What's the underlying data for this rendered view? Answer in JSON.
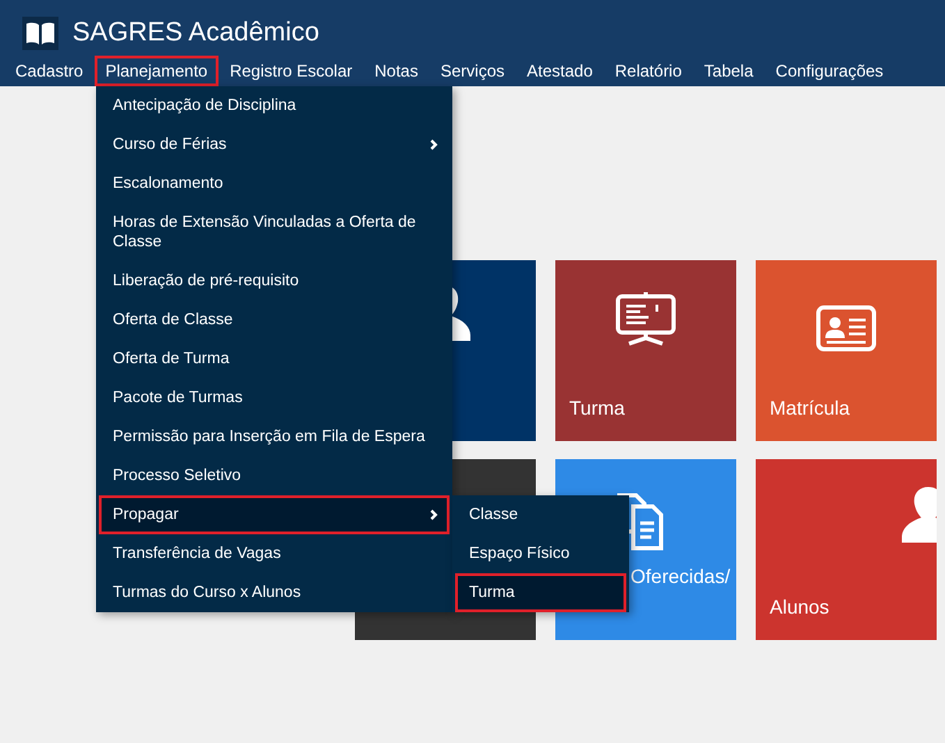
{
  "header": {
    "title": "SAGRES Acadêmico"
  },
  "nav": [
    {
      "label": "Cadastro",
      "selected": false
    },
    {
      "label": "Planejamento",
      "selected": true
    },
    {
      "label": "Registro Escolar",
      "selected": false
    },
    {
      "label": "Notas",
      "selected": false
    },
    {
      "label": "Serviços",
      "selected": false
    },
    {
      "label": "Atestado",
      "selected": false
    },
    {
      "label": "Relatório",
      "selected": false
    },
    {
      "label": "Tabela",
      "selected": false
    },
    {
      "label": "Configurações",
      "selected": false
    }
  ],
  "menu": [
    {
      "label": "Antecipação de Disciplina",
      "selected": false,
      "has_submenu": false
    },
    {
      "label": "Curso de Férias",
      "selected": false,
      "has_submenu": true
    },
    {
      "label": "Escalonamento",
      "selected": false,
      "has_submenu": false
    },
    {
      "label": "Horas de Extensão Vinculadas a Oferta de Classe",
      "selected": false,
      "has_submenu": false
    },
    {
      "label": "Liberação de pré-requisito",
      "selected": false,
      "has_submenu": false
    },
    {
      "label": "Oferta de Classe",
      "selected": false,
      "has_submenu": false
    },
    {
      "label": "Oferta de Turma",
      "selected": false,
      "has_submenu": false
    },
    {
      "label": "Pacote de Turmas",
      "selected": false,
      "has_submenu": false
    },
    {
      "label": "Permissão para Inserção em Fila de Espera",
      "selected": false,
      "has_submenu": false
    },
    {
      "label": "Processo Seletivo",
      "selected": false,
      "has_submenu": false
    },
    {
      "label": "Propagar",
      "selected": true,
      "has_submenu": true
    },
    {
      "label": "Transferência de Vagas",
      "selected": false,
      "has_submenu": false
    },
    {
      "label": "Turmas do Curso x Alunos",
      "selected": false,
      "has_submenu": false
    }
  ],
  "submenu": [
    {
      "label": "Classe",
      "selected": false
    },
    {
      "label": "Espaço Físico",
      "selected": false
    },
    {
      "label": "Turma",
      "selected": true
    }
  ],
  "tiles": [
    {
      "kind": "person",
      "color": "#003366"
    },
    {
      "kind": "board",
      "label": "Turma",
      "color": "#993333"
    },
    {
      "kind": "card",
      "label": "Matrícula",
      "color": "#db532f"
    },
    {
      "kind": "none",
      "color": "#333333"
    },
    {
      "kind": "docs",
      "label": "Oferecidas/",
      "color": "#2e8ae6"
    },
    {
      "kind": "person",
      "label": "Alunos",
      "color": "#cc342e"
    }
  ]
}
